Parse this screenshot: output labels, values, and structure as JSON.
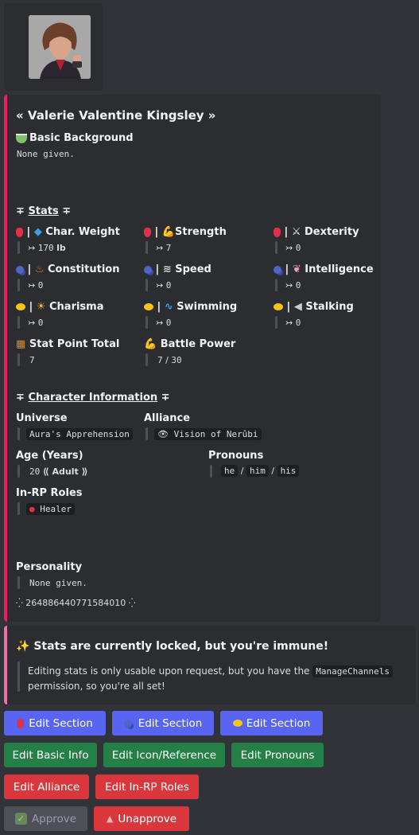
{
  "profile": {
    "name": "« Valerie Valentine Kingsley »",
    "background_label": "Basic Background",
    "background_value": "None given."
  },
  "stats": {
    "header_prefix": "∓",
    "header": "Stats",
    "header_suffix": "∓",
    "arrow": "↣",
    "sep": "|",
    "items": [
      {
        "label": "Char. Weight",
        "value": "170",
        "unit": "lb"
      },
      {
        "label": "Strength",
        "value": "7"
      },
      {
        "label": "Dexterity",
        "value": "0"
      },
      {
        "label": "Constitution",
        "value": "0"
      },
      {
        "label": "Speed",
        "value": "0"
      },
      {
        "label": "Intelligence",
        "value": "0"
      },
      {
        "label": "Charisma",
        "value": "0"
      },
      {
        "label": "Swimming",
        "value": "0"
      },
      {
        "label": "Stalking",
        "value": "0"
      }
    ],
    "total_label": "Stat Point Total",
    "total_value": "7",
    "battle_label": "Battle Power",
    "battle_value": "7",
    "battle_sep": "/",
    "battle_max": "30"
  },
  "character": {
    "header_prefix": "∓",
    "header": "Character Information",
    "header_suffix": "∓",
    "universe_label": "Universe",
    "universe_value": "Aura's Apprehension",
    "alliance_label": "Alliance",
    "alliance_value": "Vision of Nerûbi",
    "age_label": "Age (Years)",
    "age_value": "20",
    "age_category": "⟪ Adult ⟫",
    "pronouns_label": "Pronouns",
    "pronouns": [
      "he",
      "him",
      "his"
    ],
    "pronoun_sep": "/",
    "roles_label": "In-RP Roles",
    "roles_value": "Healer",
    "personality_label": "Personality",
    "personality_value": "None given.",
    "id_line": "⁛ 264886440771584010 ⁛"
  },
  "notice": {
    "title": "Stats are currently locked, but you're immune!",
    "body_1": "Editing stats is only usable upon request, but you have the",
    "code": "ManageChannels",
    "body_2": "permission, so you're all set!"
  },
  "buttons": {
    "edit_section_1": "Edit Section",
    "edit_section_2": "Edit Section",
    "edit_section_3": "Edit Section",
    "edit_basic_info": "Edit Basic Info",
    "edit_icon_reference": "Edit Icon/Reference",
    "edit_pronouns": "Edit Pronouns",
    "edit_alliance": "Edit Alliance",
    "edit_in_rp_roles": "Edit In-RP Roles",
    "approve": "Approve",
    "unapprove": "Unapprove"
  },
  "colors": {
    "card_accent": "#e91e63",
    "notice_accent": "#ef6fab",
    "blurple": "#5865f2",
    "green": "#248046",
    "red": "#da373c"
  }
}
